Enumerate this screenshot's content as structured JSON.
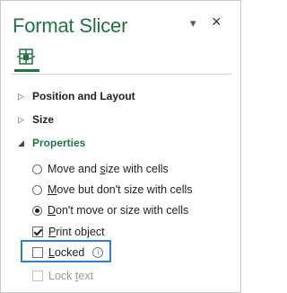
{
  "pane": {
    "title": "Format Slicer",
    "dropdown_icon": "chevron-down-icon",
    "close_icon": "close-icon",
    "tab_icon": "slicer-settings-icon"
  },
  "sections": [
    {
      "label": "Position and Layout",
      "state": "collapsed"
    },
    {
      "label": "Size",
      "state": "collapsed"
    },
    {
      "label": "Properties",
      "state": "expanded"
    }
  ],
  "properties": {
    "radio_options": [
      {
        "label": "Move and size with cells",
        "mnemonic_index": 8,
        "selected": false
      },
      {
        "label": "Move but don't size with cells",
        "mnemonic_index": 0,
        "selected": false
      },
      {
        "label": "Don't move or size with cells",
        "mnemonic_index": 0,
        "selected": true
      }
    ],
    "print_object": {
      "label": "Print object",
      "checked": true
    },
    "locked": {
      "label": "Locked",
      "checked": false
    },
    "lock_text": {
      "label": "Lock text",
      "checked": false,
      "disabled": true
    }
  },
  "colors": {
    "accent": "#217346",
    "highlight_box": "#2b80d3"
  }
}
